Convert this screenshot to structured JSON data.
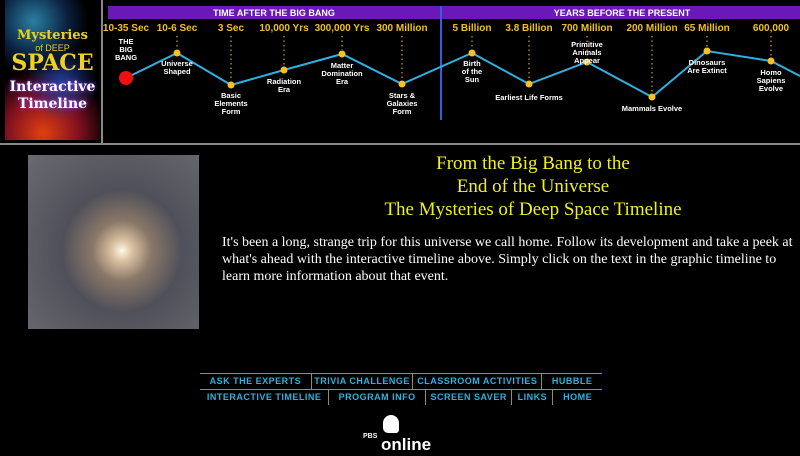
{
  "logo": {
    "line1": "Mysteries",
    "line2": "of DEEP",
    "line3": "SPACE",
    "line4": "Interactive",
    "line5": "Timeline"
  },
  "timeline": {
    "header_left": "TIME AFTER THE BIG BANG",
    "header_right": "YEARS BEFORE THE PRESENT",
    "events": [
      {
        "time": "10-35 Sec",
        "label": [
          "THE",
          "BIG",
          "BANG"
        ]
      },
      {
        "time": "10-6 Sec",
        "label": [
          "Universe",
          "Shaped"
        ]
      },
      {
        "time": "3 Sec",
        "label": [
          "Basic",
          "Elements",
          "Form"
        ]
      },
      {
        "time": "10,000 Yrs",
        "label": [
          "Radiation",
          "Era"
        ]
      },
      {
        "time": "300,000 Yrs",
        "label": [
          "Matter",
          "Domination",
          "Era"
        ]
      },
      {
        "time": "300 Million",
        "label": [
          "Stars &",
          "Galaxies",
          "Form"
        ]
      },
      {
        "time": "5 Billion",
        "label": [
          "Birth",
          "of the",
          "Sun"
        ]
      },
      {
        "time": "3.8 Billion",
        "label": [
          "Earliest Life Forms"
        ]
      },
      {
        "time": "700 Million",
        "label": [
          "Primitive",
          "Animals",
          "Appear"
        ]
      },
      {
        "time": "200 Million",
        "label": [
          "Mammals Evolve"
        ]
      },
      {
        "time": "65 Million",
        "label": [
          "Dinosaurs",
          "Are Extinct"
        ]
      },
      {
        "time": "600,000",
        "label": [
          "Homo",
          "Sapiens",
          "Evolve"
        ]
      }
    ]
  },
  "heading": [
    "From the Big Bang to the",
    "End of the Universe",
    "The Mysteries of Deep Space Timeline"
  ],
  "intro": "It's been a long, strange trip for this universe we call home. Follow its development and take a peek at what's ahead with the interactive timeline above. Simply click on the text in the graphic timeline to learn more information about that event.",
  "nav": {
    "row1": [
      "ASK THE EXPERTS",
      "TRIVIA CHALLENGE",
      "CLASSROOM ACTIVITIES",
      "HUBBLE"
    ],
    "row2": [
      "INTERACTIVE TIMELINE",
      "PROGRAM INFO",
      "SCREEN SAVER",
      "LINKS",
      "HOME"
    ]
  },
  "pbs": {
    "brand": "PBS",
    "online": "online"
  },
  "colors": {
    "header": "#6a18b8",
    "line": "#30b0e0",
    "dot": "#f8c020",
    "time": "#f0c020"
  }
}
